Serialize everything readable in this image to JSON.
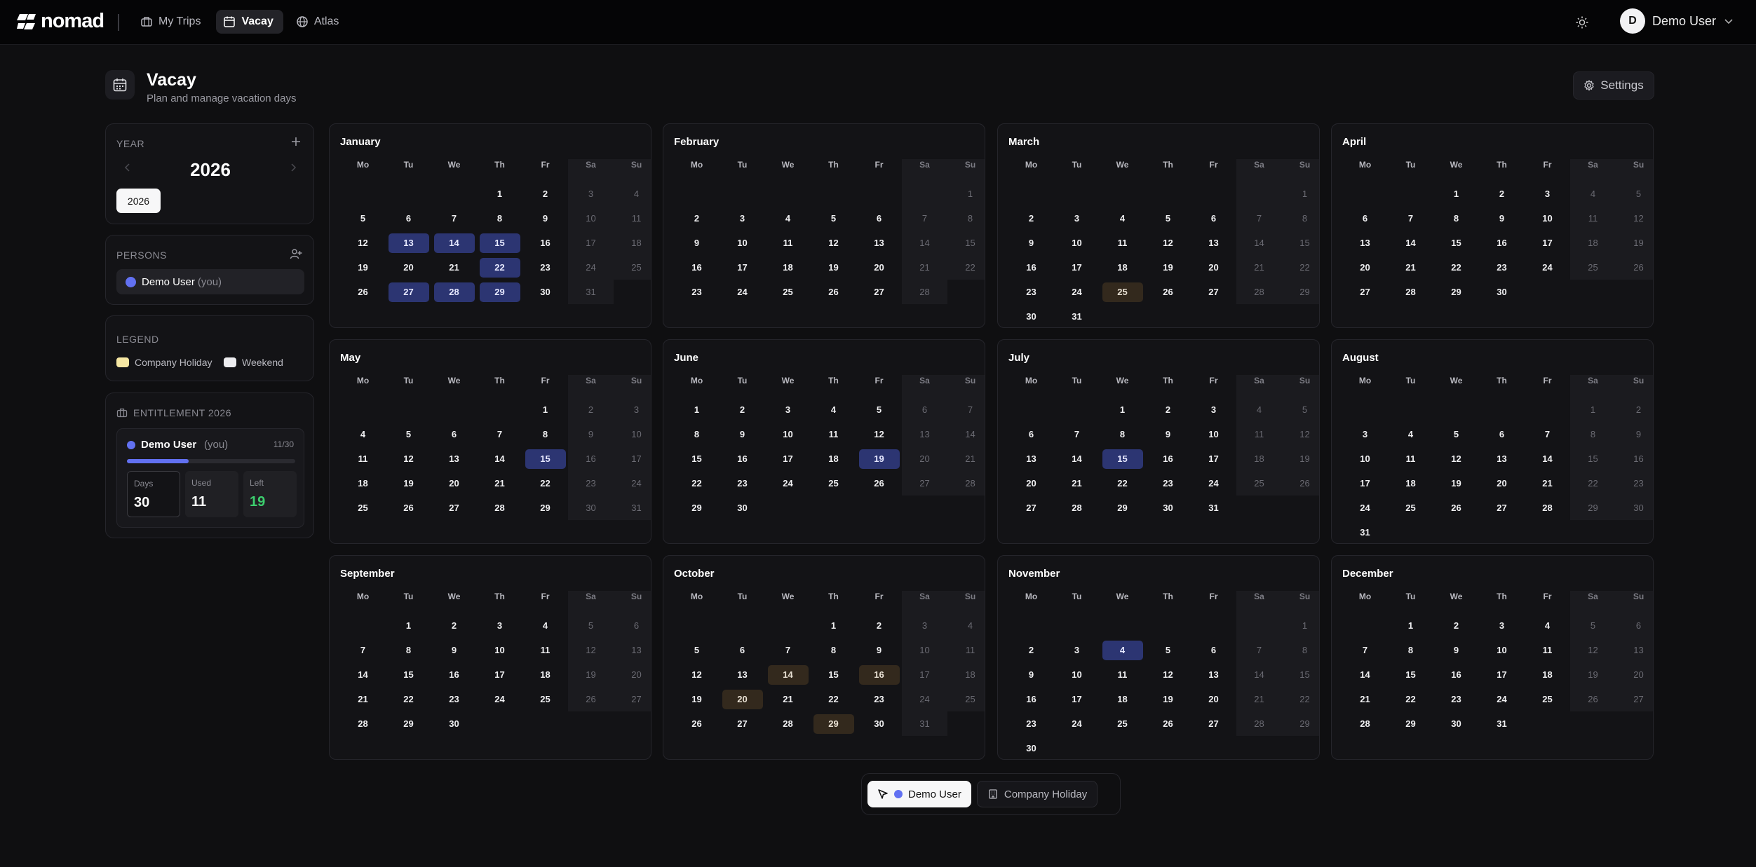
{
  "app": {
    "logo_text": "nomad"
  },
  "nav": [
    {
      "label": "My Trips",
      "icon": "briefcase-icon"
    },
    {
      "label": "Vacay",
      "icon": "calendar-icon",
      "active": true
    },
    {
      "label": "Atlas",
      "icon": "globe-icon"
    }
  ],
  "user": {
    "initial": "D",
    "name": "Demo User"
  },
  "page": {
    "title": "Vacay",
    "subtitle": "Plan and manage vacation days",
    "settings_label": "Settings"
  },
  "sidebar": {
    "year": {
      "label": "YEAR",
      "value": "2026",
      "chip": "2026"
    },
    "persons": {
      "label": "PERSONS",
      "items": [
        {
          "name": "Demo User",
          "suffix": "(you)",
          "color": "#6271f2"
        }
      ]
    },
    "legend": {
      "label": "LEGEND",
      "items": [
        {
          "label": "Company Holiday",
          "color": "#f6e7a3"
        },
        {
          "label": "Weekend",
          "color": "#ededf0"
        }
      ]
    },
    "entitlement": {
      "label": "ENTITLEMENT 2026",
      "person": "Demo User",
      "suffix": "(you)",
      "ratio": "11/30",
      "progress": 0.367,
      "days_label": "Days",
      "days": "30",
      "used_label": "Used",
      "used": "11",
      "left_label": "Left",
      "left": "19"
    }
  },
  "calendar": {
    "weekdays": [
      "Mo",
      "Tu",
      "We",
      "Th",
      "Fr",
      "Sa",
      "Su"
    ],
    "months": [
      {
        "name": "January",
        "start": 3,
        "days": 31,
        "vacation": [
          13,
          14,
          15,
          22,
          27,
          28,
          29
        ],
        "holiday": []
      },
      {
        "name": "February",
        "start": 6,
        "days": 28,
        "vacation": [],
        "holiday": []
      },
      {
        "name": "March",
        "start": 6,
        "days": 31,
        "vacation": [],
        "holiday": [
          25
        ]
      },
      {
        "name": "April",
        "start": 2,
        "days": 30,
        "vacation": [],
        "holiday": []
      },
      {
        "name": "May",
        "start": 4,
        "days": 31,
        "vacation": [
          15
        ],
        "holiday": []
      },
      {
        "name": "June",
        "start": 0,
        "days": 30,
        "vacation": [
          19
        ],
        "holiday": []
      },
      {
        "name": "July",
        "start": 2,
        "days": 31,
        "vacation": [
          15
        ],
        "holiday": []
      },
      {
        "name": "August",
        "start": 5,
        "days": 31,
        "vacation": [],
        "holiday": []
      },
      {
        "name": "September",
        "start": 1,
        "days": 30,
        "vacation": [],
        "holiday": []
      },
      {
        "name": "October",
        "start": 3,
        "days": 31,
        "vacation": [],
        "holiday": [
          14,
          16,
          20,
          29
        ]
      },
      {
        "name": "November",
        "start": 6,
        "days": 30,
        "vacation": [
          4
        ],
        "holiday": []
      },
      {
        "name": "December",
        "start": 1,
        "days": 31,
        "vacation": [],
        "holiday": []
      }
    ]
  },
  "toolbar": {
    "person_label": "Demo User",
    "person_color": "#6271f2",
    "holiday_label": "Company Holiday"
  }
}
